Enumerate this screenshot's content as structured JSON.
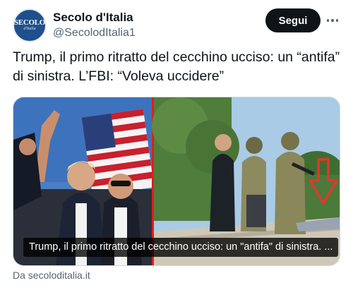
{
  "account": {
    "name": "Secolo d'Italia",
    "handle": "@SecolodItalia1",
    "avatar_text": "SECOLO",
    "avatar_subtext": "d'Italia",
    "follow_label": "Segui",
    "more_icon": "more-horizontal-icon"
  },
  "tweet": {
    "text": "Trump, il primo ritratto del cecchino ucciso: un “antifa” di sinistra. L’FBI: “Voleva uccidere”"
  },
  "media": {
    "caption": "Trump, il primo ritratto del cecchino ucciso: un \"antifa\" di sinistra. ...",
    "arrow_color": "#e0382d",
    "divider_color": "#e11d1d"
  },
  "link": {
    "source": "Da secoloditalia.it"
  },
  "colors": {
    "follow_bg": "#0f1419",
    "avatar_bg": "#1f4f8c",
    "secondary_text": "#536471"
  }
}
